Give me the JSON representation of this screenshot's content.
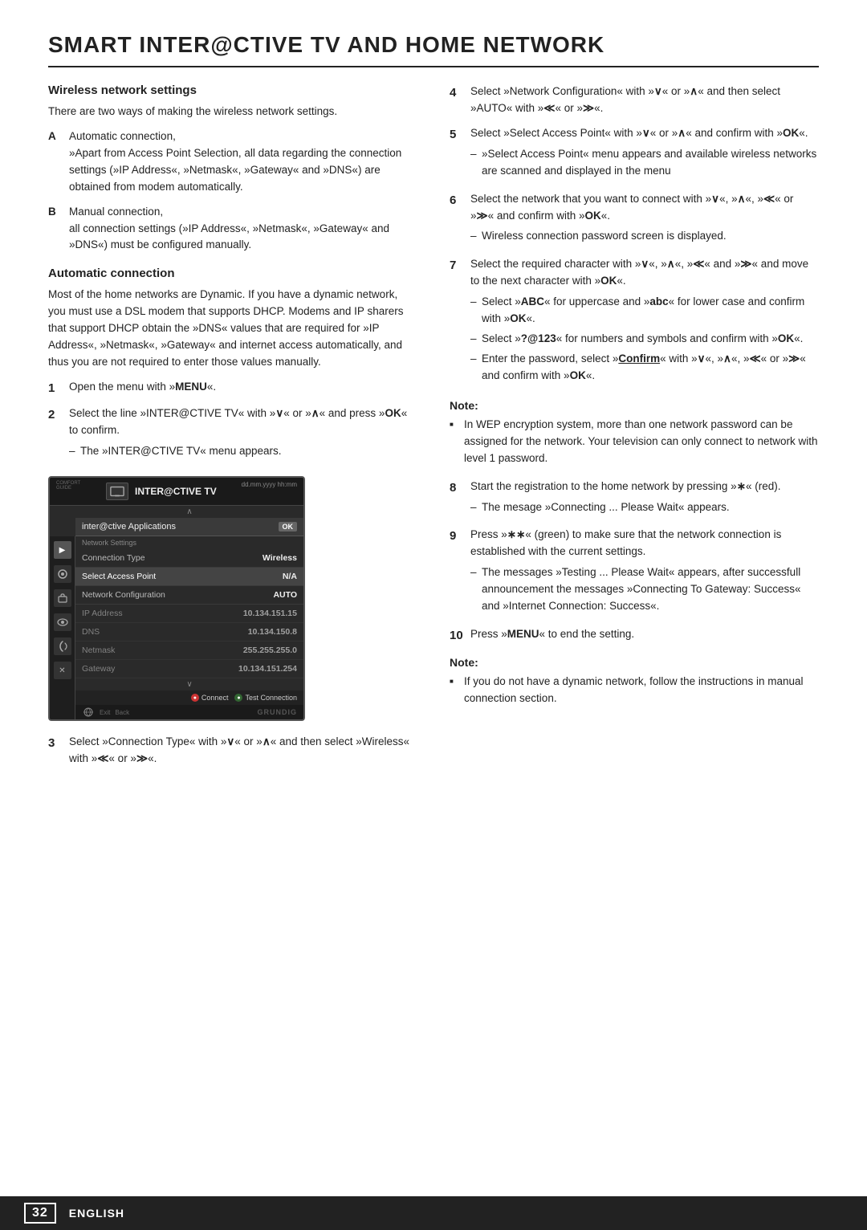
{
  "title": "SMART INTER@CTIVE TV AND HOME NETWORK",
  "left_col": {
    "wireless_title": "Wireless network settings",
    "wireless_intro": "There are two ways of making the wireless network settings.",
    "connection_types": [
      {
        "letter": "A",
        "text": "Automatic connection,\n»Apart from Access Point Selection, all data regarding the connection settings (»IP Address«, »Netmask«, »Gateway« and »DNS«) are obtained from modem automatically."
      },
      {
        "letter": "B",
        "text": "Manual connection,\nall connection settings (»IP Address«, »Netmask«, »Gateway« and »DNS«) must be configured manually."
      }
    ],
    "auto_title": "Automatic connection",
    "auto_text": "Most of the home networks are Dynamic. If you have a dynamic network, you must use a DSL modem that supports DHCP. Modems and IP sharers that support DHCP obtain the »DNS« values that are required for »IP Address«, »Netmask«, »Gateway« and internet access automatically, and thus you are not required to enter those values manually.",
    "steps_left": [
      {
        "num": "1",
        "text": "Open the menu with »",
        "bold": "MENU",
        "text2": "«."
      },
      {
        "num": "2",
        "text": "Select the line »INTER@CTIVE TV« with »",
        "bold1": "∨",
        "text3": "« or »",
        "bold2": "∧",
        "text4": "« and press »",
        "bold3": "OK",
        "text5": "« to confirm.",
        "sub": [
          "The »INTER@CTIVE TV« menu appears."
        ]
      }
    ],
    "step3": {
      "num": "3",
      "text": "Select »Connection Type« with »",
      "bold1": "∨",
      "t2": "« or »",
      "bold2": "∧",
      "t3": "« and then select »Wireless« with »",
      "bold3": "≪",
      "t4": "« or »",
      "bold4": "≫",
      "t5": "«."
    },
    "tv_menu": {
      "header_title": "INTER@CTIVE TV",
      "datetime": "dd.mm.yyyy\nhh:mm",
      "app_bar": "inter@ctive Applications",
      "ok_label": "OK",
      "section_label": "Network Settings",
      "rows": [
        {
          "label": "Connection Type",
          "value": "Wireless",
          "highlighted": false
        },
        {
          "label": "Select Access Point",
          "value": "N/A",
          "highlighted": true
        },
        {
          "label": "Network Configuration",
          "value": "AUTO",
          "highlighted": false
        },
        {
          "label": "IP Address",
          "value": "10.134.151.15",
          "highlighted": false,
          "dimmed": true
        },
        {
          "label": "DNS",
          "value": "10.134.150.8",
          "highlighted": false,
          "dimmed": true
        },
        {
          "label": "Netmask",
          "value": "255.255.255.0",
          "highlighted": false,
          "dimmed": true
        },
        {
          "label": "Gateway",
          "value": "10.134.151.254",
          "highlighted": false,
          "dimmed": true
        }
      ],
      "footer_buttons": [
        {
          "color": "red",
          "label": "Connect"
        },
        {
          "color": "green",
          "label": "Test Connection"
        }
      ],
      "footer_nav": "Exit  Back"
    }
  },
  "right_col": {
    "steps": [
      {
        "num": "4",
        "text": "Select »Network Configuration« with »∨« or »∧« and then select »AUTO« with »≪« or »≫«."
      },
      {
        "num": "5",
        "text": "Select »Select Access Point« with »∨« or »∧« and confirm with »OK«.",
        "sub": [
          "»Select Access Point« menu appears and available wireless networks are scanned and displayed in the menu"
        ]
      },
      {
        "num": "6",
        "text": "Select the network that you want to connect with »∨«, »∧«, »≪« or »≫« and confirm with »OK«.",
        "sub": [
          "Wireless connection password screen is displayed."
        ]
      },
      {
        "num": "7",
        "text": "Select the required character with »∨«, »∧«, »≪« and »≫« and move to the next character with »OK«.",
        "sub": [
          "Select »ABC« for uppercase and »abc« for lower case and confirm with »OK«.",
          "Select »?@123« for numbers and symbols and confirm with »OK«.",
          "Enter the password, select »Confirm« with »∨«, »∧«, »≪« or »≫« and confirm with »OK«."
        ]
      }
    ],
    "note1": {
      "title": "Note:",
      "bullets": [
        "In WEP encryption system, more than one network password can be assigned for the network. Your television can only connect to network with level 1 password."
      ]
    },
    "steps2": [
      {
        "num": "8",
        "text": "Start the registration to the home network by pressing »∗« (red).",
        "sub": [
          "The mesage »Connecting ... Please Wait« appears."
        ]
      },
      {
        "num": "9",
        "text": "Press »∗∗« (green) to make sure that the network connection is established with the current settings.",
        "sub": [
          "The messages »Testing ... Please Wait« appears, after successfull announcement the messages »Connecting To Gateway: Success« and »Internet Connection: Success«."
        ]
      },
      {
        "num": "10",
        "text": "Press »MENU« to end the setting."
      }
    ],
    "note2": {
      "title": "Note:",
      "bullets": [
        "If you do not have a dynamic network, follow the instructions in manual connection section."
      ]
    }
  },
  "footer": {
    "page_number": "32",
    "language": "ENGLISH"
  }
}
